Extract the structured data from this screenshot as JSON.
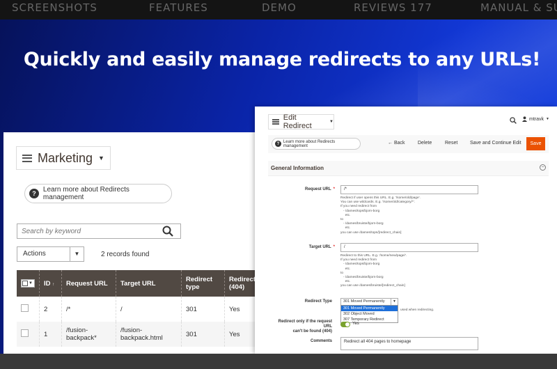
{
  "topnav": {
    "items": [
      "SCREENSHOTS",
      "FEATURES",
      "DEMO",
      "REVIEWS 177",
      "MANUAL & SUPPORT"
    ]
  },
  "hero": {
    "headline": "Quickly and easily manage redirects to any URLs!"
  },
  "grid_panel": {
    "title": "Marketing",
    "learn_more": "Learn more about Redirects management",
    "search_placeholder": "Search by keyword",
    "actions_label": "Actions",
    "records_found": "2 records found",
    "columns": [
      "ID",
      "Request URL",
      "Target URL",
      "Redirect type",
      "Redirect (404)"
    ],
    "rows": [
      {
        "id": "2",
        "request_url": "/*",
        "target_url": "/",
        "type": "301",
        "redirect404": "Yes"
      },
      {
        "id": "1",
        "request_url": "/fusion-backpack*",
        "target_url": "/fusion-backpack.html",
        "type": "301",
        "redirect404": "Yes"
      }
    ]
  },
  "edit_panel": {
    "title": "Edit Redirect",
    "username": "mtravk",
    "learn_more": "Learn more about Redirects management",
    "toolbar": {
      "back": "Back",
      "delete": "Delete",
      "reset": "Reset",
      "save_continue": "Save and Continue Edit",
      "save": "Save"
    },
    "section_title": "General Information",
    "request_url": {
      "label": "Request URL",
      "value": "/*",
      "note": "Redirect if user opens this URL. E.g. '/some/old/page'.\nYou can use wildcards. E.g. '/some/old/category/*'.\nIf you need redirect from\n   - /dames/tops/bjorn-borg\n     etc.\nto\n   - /dames/bruiste/bjorn-borg\n     etc.\nyou can use /dames/tops/[redirect_chain]"
    },
    "target_url": {
      "label": "Target URL",
      "value": "/",
      "note": "Redirect to this URL. E.g. '/some/new/page/'.\nIf you need redirect from\n   - /dames/tops/bjorn-borg\n     etc.\nto\n   - /dames/bruiste/bjorn-borg\n     etc.\nyou can use /dames/bruiste/[redirect_chain]"
    },
    "redirect_type": {
      "label": "Redirect Type",
      "selected": "301 Moved Permanently",
      "options": [
        "301 Moved Permanently",
        "302 Object Moved",
        "307 Temporary Redirect"
      ],
      "note_tail": "used when redirecting."
    },
    "only_404": {
      "label_line1": "Redirect only if the request URL",
      "label_line2": "can't be found (404)",
      "value": "Yes"
    },
    "comments": {
      "label": "Comments",
      "value": "Redirect all 404 pages to homepage"
    }
  },
  "colors": {
    "save_orange": "#eb5202",
    "grid_header": "#514943",
    "hero_blue": "#0a24a8",
    "toggle_green": "#79a22e",
    "option_highlight": "#1e6fd9"
  }
}
